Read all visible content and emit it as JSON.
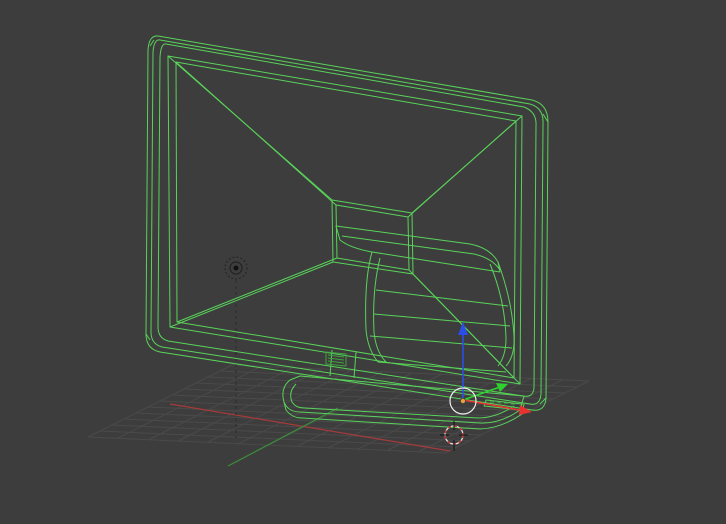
{
  "viewport": {
    "mode": "wireframe",
    "object_type": "monitor-mesh",
    "selected": true,
    "colors": {
      "background": "#3d3d3d",
      "grid": "#4a4a4a",
      "x_axis": "#a53a3a",
      "y_axis": "#3a8f3a",
      "wire_selected": "#59d35a",
      "gizmo_x": "#e83232",
      "gizmo_y": "#2fd12f",
      "gizmo_z": "#2a4fe8"
    },
    "icons": {
      "cursor": "3d-cursor-icon",
      "lamp": "lamp-icon",
      "pivot": "pivot-circle-icon",
      "origin": "object-origin-icon"
    }
  }
}
